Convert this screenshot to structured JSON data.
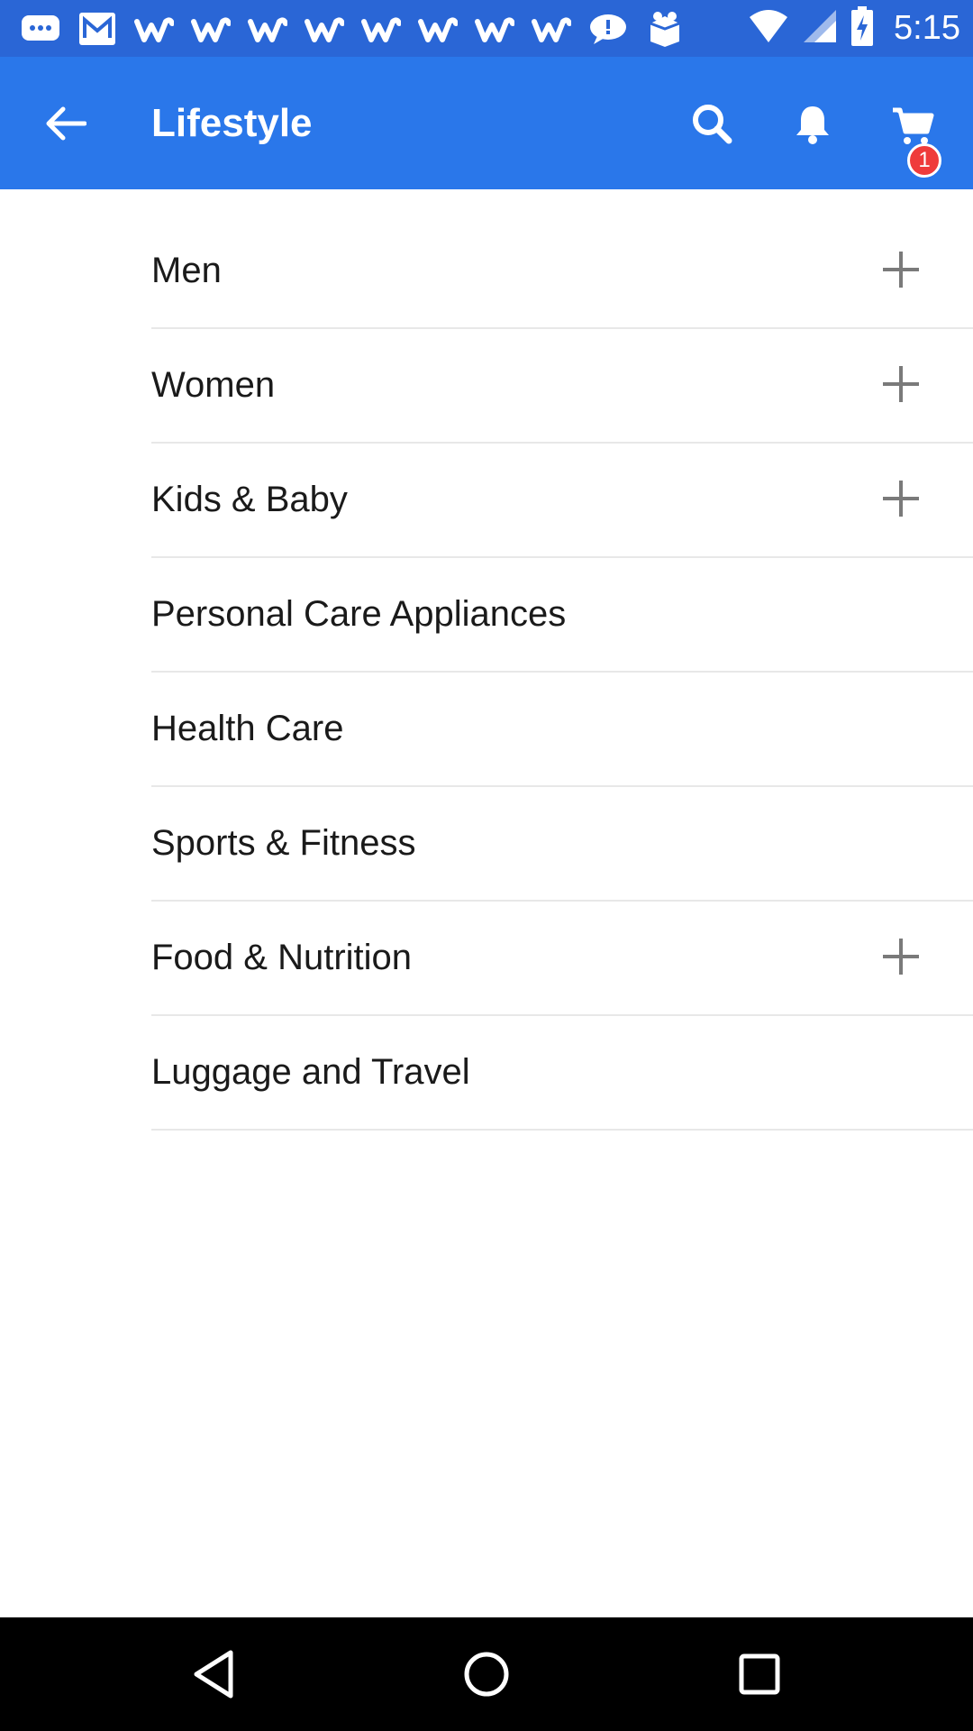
{
  "status_bar": {
    "time": "5:15",
    "notification_icons": [
      "message-icon",
      "mail-icon",
      "w-app-icon",
      "w-app-icon",
      "w-app-icon",
      "w-app-icon",
      "w-app-icon",
      "w-app-icon",
      "w-app-icon",
      "w-app-icon",
      "chat-bubble-icon",
      "package-icon"
    ],
    "system_icons": [
      "wifi-icon",
      "signal-icon",
      "battery-charging-icon"
    ],
    "background": "#2a66d6"
  },
  "app_bar": {
    "title": "Lifestyle",
    "background": "#2a77ea",
    "cart_badge": "1",
    "badge_color": "#ef3b3b"
  },
  "categories": [
    {
      "label": "Men",
      "expandable": true
    },
    {
      "label": "Women",
      "expandable": true
    },
    {
      "label": "Kids & Baby",
      "expandable": true
    },
    {
      "label": "Personal Care Appliances",
      "expandable": false
    },
    {
      "label": "Health Care",
      "expandable": false
    },
    {
      "label": "Sports & Fitness",
      "expandable": false
    },
    {
      "label": "Food & Nutrition",
      "expandable": true
    },
    {
      "label": "Luggage and Travel",
      "expandable": false
    }
  ]
}
